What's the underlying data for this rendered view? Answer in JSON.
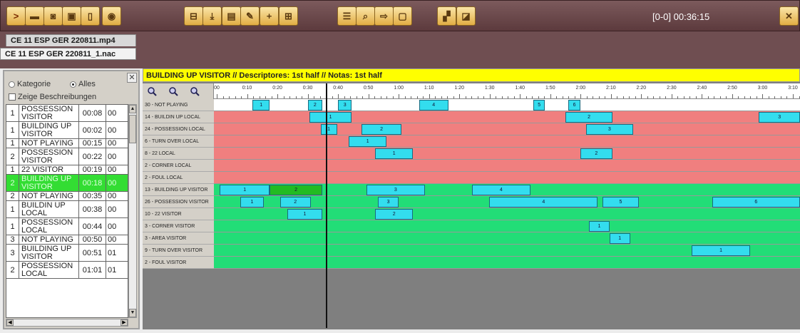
{
  "toolbar": {
    "buttons": [
      {
        "name": "play-button",
        "glyph": ">"
      },
      {
        "name": "capture-button",
        "glyph": "▬"
      },
      {
        "name": "camera-button",
        "glyph": "◙"
      },
      {
        "name": "film-button",
        "glyph": "▣"
      },
      {
        "name": "panel-button",
        "glyph": "▯"
      },
      {
        "name": "view-button",
        "glyph": "◉"
      },
      {
        "name": "layout-button",
        "glyph": "⊟"
      },
      {
        "name": "import-button",
        "glyph": "⤓"
      },
      {
        "name": "document-button",
        "glyph": "▤"
      },
      {
        "name": "edit-button",
        "glyph": "✎"
      },
      {
        "name": "add-button",
        "glyph": "+"
      },
      {
        "name": "grid-button",
        "glyph": "⊞"
      },
      {
        "name": "list-button",
        "glyph": "☰"
      },
      {
        "name": "search-button",
        "glyph": "⌕"
      },
      {
        "name": "export-button",
        "glyph": "⇨"
      },
      {
        "name": "save-button",
        "glyph": "▢"
      },
      {
        "name": "image-button",
        "glyph": "▞"
      },
      {
        "name": "chart-button",
        "glyph": "◪"
      }
    ],
    "timecode": "[0-0]  00:36:15",
    "close_glyph": "✕"
  },
  "tabs": {
    "video": "CE 11 ESP GER 220811.mp4",
    "nac": "CE 11 ESP GER 220811_1.nac"
  },
  "left_panel": {
    "radio_kategorie": "Kategorie",
    "radio_alles": "Alles",
    "checkbox_label": "Zeige Beschreibungen",
    "close_glyph": "✕",
    "events": [
      {
        "num": "1",
        "name": "POSSESSION VISITOR",
        "time": "00:08",
        "end": "00"
      },
      {
        "num": "1",
        "name": "BUILDING UP VISITOR",
        "time": "00:02",
        "end": "00"
      },
      {
        "num": "1",
        "name": "NOT PLAYING",
        "time": "00:15",
        "end": "00"
      },
      {
        "num": "2",
        "name": "POSSESSION VISITOR",
        "time": "00:22",
        "end": "00"
      },
      {
        "num": "1",
        "name": "22 VISITOR",
        "time": "00:19",
        "end": "00"
      },
      {
        "num": "2",
        "name": "BUILDING UP VISITOR",
        "time": "00:18",
        "end": "00",
        "active": true
      },
      {
        "num": "2",
        "name": "NOT PLAYING",
        "time": "00:35",
        "end": "00"
      },
      {
        "num": "1",
        "name": "BUILDIN UP LOCAL",
        "time": "00:38",
        "end": "00"
      },
      {
        "num": "1",
        "name": "POSSESSION LOCAL",
        "time": "00:44",
        "end": "00"
      },
      {
        "num": "3",
        "name": "NOT PLAYING",
        "time": "00:50",
        "end": "00"
      },
      {
        "num": "3",
        "name": "BUILDING UP VISITOR",
        "time": "00:51",
        "end": "01"
      },
      {
        "num": "2",
        "name": "POSSESSION LOCAL",
        "time": "01:01",
        "end": "01"
      }
    ]
  },
  "timeline": {
    "title": "BUILDING UP VISITOR // Descriptores: 1st half // Notas: 1st half",
    "ticks": [
      "00",
      "0:10",
      "0:20",
      "0:30",
      "0:40",
      "0:50",
      "1:00",
      "1:10",
      "1:20",
      "1:30",
      "1:40",
      "1:50",
      "2:00",
      "2:10",
      "2:20",
      "2:30",
      "2:40",
      "2:50",
      "3:00",
      "3:10"
    ],
    "tracks": [
      {
        "label": "30 - NOT PLAYING",
        "color": "#ffffff",
        "events": [
          {
            "n": "1",
            "s": 6.6,
            "e": 9.5
          },
          {
            "n": "2",
            "s": 16,
            "e": 18.5
          },
          {
            "n": "3",
            "s": 21.2,
            "e": 23.5
          },
          {
            "n": "4",
            "s": 35,
            "e": 40
          },
          {
            "n": "5",
            "s": 54.5,
            "e": 56.5
          },
          {
            "n": "6",
            "s": 60.5,
            "e": 62.5
          }
        ]
      },
      {
        "label": "14 - BUILDIN UP LOCAL",
        "color": "#f07f7f",
        "events": [
          {
            "n": "1",
            "s": 16.3,
            "e": 23.5
          },
          {
            "n": "2",
            "s": 60,
            "e": 68
          },
          {
            "n": "3",
            "s": 93,
            "e": 100
          }
        ]
      },
      {
        "label": "24 - POSSESSION LOCAL",
        "color": "#f07f7f",
        "events": [
          {
            "n": "1",
            "s": 18.2,
            "e": 21
          },
          {
            "n": "2",
            "s": 25.2,
            "e": 32
          },
          {
            "n": "3",
            "s": 63.5,
            "e": 71.5
          }
        ]
      },
      {
        "label": "6 - TURN OVER LOCAL",
        "color": "#f07f7f",
        "events": [
          {
            "n": "1",
            "s": 23,
            "e": 29.5
          }
        ]
      },
      {
        "label": "8 - 22 LOCAL",
        "color": "#f07f7f",
        "events": [
          {
            "n": "1",
            "s": 27.5,
            "e": 34
          },
          {
            "n": "2",
            "s": 62.5,
            "e": 68
          }
        ]
      },
      {
        "label": "2 - CORNER LOCAL",
        "color": "#f07f7f",
        "events": []
      },
      {
        "label": "2 - FOUL LOCAL",
        "color": "#f07f7f",
        "events": []
      },
      {
        "label": "13 - BUILDING UP VISITOR",
        "color": "#22dd77",
        "events": [
          {
            "n": "1",
            "s": 1,
            "e": 9.5
          },
          {
            "n": "2",
            "s": 9.5,
            "e": 18.5,
            "sel": true
          },
          {
            "n": "3",
            "s": 26,
            "e": 36
          },
          {
            "n": "4",
            "s": 44,
            "e": 54
          }
        ]
      },
      {
        "label": "26 - POSSESSION VISITOR",
        "color": "#22dd77",
        "events": [
          {
            "n": "1",
            "s": 4.5,
            "e": 8.5
          },
          {
            "n": "2",
            "s": 11.3,
            "e": 16.5
          },
          {
            "n": "3",
            "s": 28,
            "e": 31.5
          },
          {
            "n": "4",
            "s": 47,
            "e": 65.5
          },
          {
            "n": "5",
            "s": 66.3,
            "e": 72.5
          },
          {
            "n": "6",
            "s": 85,
            "e": 100
          }
        ]
      },
      {
        "label": "10 - 22 VISITOR",
        "color": "#22dd77",
        "events": [
          {
            "n": "1",
            "s": 12.5,
            "e": 18.5
          },
          {
            "n": "2",
            "s": 27.5,
            "e": 34
          }
        ]
      },
      {
        "label": "3 - CORNER VISITOR",
        "color": "#22dd77",
        "events": [
          {
            "n": "1",
            "s": 64,
            "e": 67.5
          }
        ]
      },
      {
        "label": "3 - AREA VISITOR",
        "color": "#22dd77",
        "events": [
          {
            "n": "1",
            "s": 67.5,
            "e": 71
          }
        ]
      },
      {
        "label": "9 - TURN OVER VISITOR",
        "color": "#22dd77",
        "events": [
          {
            "n": "1",
            "s": 81.5,
            "e": 91.5
          }
        ]
      },
      {
        "label": "2 - FOUL VISITOR",
        "color": "#22dd77",
        "events": []
      }
    ]
  }
}
